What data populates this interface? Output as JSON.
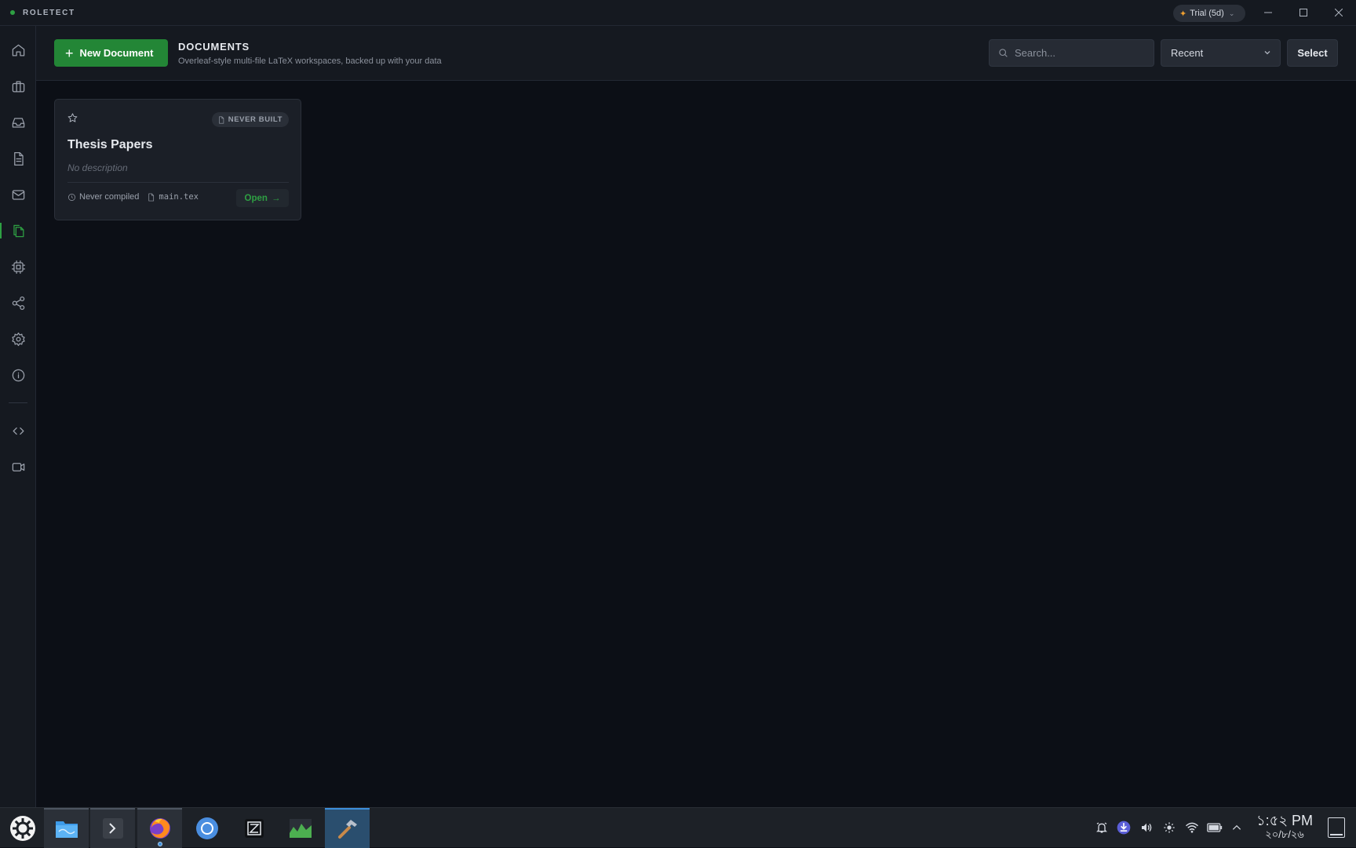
{
  "app": {
    "name": "ROLETECT",
    "trial_label": "Trial (5d)"
  },
  "header": {
    "new_button": "New Document",
    "title": "DOCUMENTS",
    "subtitle": "Overleaf-style multi-file LaTeX workspaces, backed up with your data",
    "search_placeholder": "Search...",
    "sort_value": "Recent",
    "select_label": "Select"
  },
  "sidebar": {
    "items": [
      {
        "name": "home",
        "icon": "home-icon"
      },
      {
        "name": "briefcase",
        "icon": "briefcase-icon"
      },
      {
        "name": "inbox",
        "icon": "inbox-icon"
      },
      {
        "name": "file",
        "icon": "file-text-icon"
      },
      {
        "name": "mail",
        "icon": "mail-icon"
      },
      {
        "name": "documents",
        "icon": "files-icon",
        "active": true
      },
      {
        "name": "chip",
        "icon": "cpu-icon"
      },
      {
        "name": "share",
        "icon": "share-icon"
      },
      {
        "name": "settings",
        "icon": "gear-icon"
      },
      {
        "name": "info",
        "icon": "info-icon"
      },
      {
        "name": "code",
        "icon": "code-icon"
      },
      {
        "name": "video",
        "icon": "video-icon"
      }
    ]
  },
  "documents": [
    {
      "title": "Thesis Papers",
      "description": "No description",
      "badge": "NEVER BUILT",
      "compiled": "Never compiled",
      "main_file": "main.tex",
      "open_label": "Open"
    }
  ],
  "taskbar": {
    "clock_time": "১:৫২ PM",
    "clock_date": "২০/৮/২৬"
  },
  "colors": {
    "accent": "#2ea043",
    "button_green": "#238636",
    "background": "#0c0f16"
  }
}
